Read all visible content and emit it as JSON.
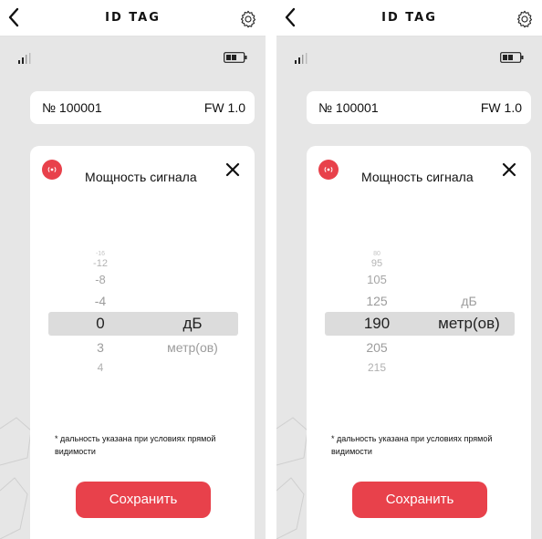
{
  "colors": {
    "accent": "#e8414b",
    "background": "#e6e6e6",
    "card": "#ffffff",
    "picker_highlight": "#dcdcdc",
    "muted_text": "#9a9a9a"
  },
  "screens": [
    {
      "header": {
        "title": "ID TAG",
        "back_icon": "chevron-left-icon",
        "settings_icon": "gear-icon"
      },
      "status": {
        "signal_icon": "signal-bars-icon",
        "battery_icon": "battery-icon"
      },
      "device": {
        "id": "№ 100001",
        "fw": "FW 1.0"
      },
      "dialog": {
        "title": "Мощность сигнала",
        "picker": {
          "values": [
            "-16",
            "-12",
            "-8",
            "-4",
            "0",
            "3",
            "4"
          ],
          "selected_value": "0",
          "units": [
            "дБ",
            "метр(ов)"
          ],
          "selected_unit": "дБ"
        },
        "footnote": "* дальность указана при условиях прямой видимости",
        "save_label": "Сохранить"
      }
    },
    {
      "header": {
        "title": "ID TAG",
        "back_icon": "chevron-left-icon",
        "settings_icon": "gear-icon"
      },
      "status": {
        "signal_icon": "signal-bars-icon",
        "battery_icon": "battery-icon"
      },
      "device": {
        "id": "№ 100001",
        "fw": "FW 1.0"
      },
      "dialog": {
        "title": "Мощность сигнала",
        "picker": {
          "values": [
            "80",
            "95",
            "105",
            "125",
            "190",
            "205",
            "215"
          ],
          "selected_value": "190",
          "units": [
            "дБ",
            "метр(ов)"
          ],
          "selected_unit": "метр(ов)"
        },
        "footnote": "* дальность указана при условиях прямой видимости",
        "save_label": "Сохранить"
      }
    }
  ]
}
